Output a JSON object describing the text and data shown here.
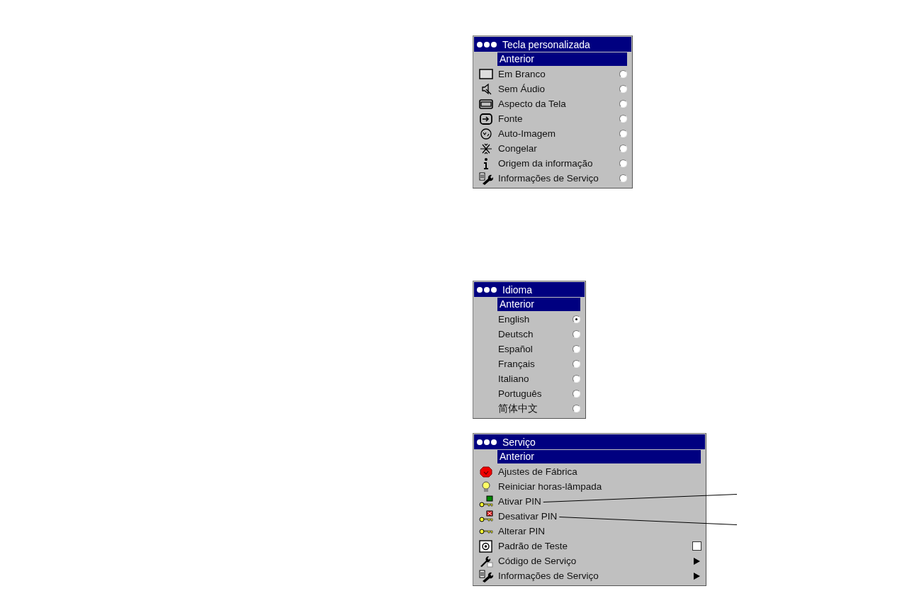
{
  "menus": [
    {
      "title": "Tecla personalizada",
      "back": {
        "label": "Anterior",
        "selected": true
      },
      "items": [
        {
          "kind": "radio",
          "label": "Em Branco",
          "selected": false
        },
        {
          "kind": "radio",
          "label": "Sem Áudio",
          "selected": false
        },
        {
          "kind": "radio",
          "label": "Aspecto da Tela",
          "selected": false
        },
        {
          "kind": "radio",
          "label": "Fonte",
          "selected": false
        },
        {
          "kind": "radio",
          "label": "Auto-Imagem",
          "selected": false
        },
        {
          "kind": "radio",
          "label": "Congelar",
          "selected": false
        },
        {
          "kind": "radio",
          "label": "Origem da informação",
          "selected": false
        },
        {
          "kind": "radio",
          "label": "Informações de Serviço",
          "selected": false
        }
      ]
    },
    {
      "title": "Idioma",
      "back": {
        "label": "Anterior",
        "selected": true
      },
      "items": [
        {
          "kind": "radio",
          "label": "English",
          "selected": true
        },
        {
          "kind": "radio",
          "label": "Deutsch",
          "selected": false
        },
        {
          "kind": "radio",
          "label": "Español",
          "selected": false
        },
        {
          "kind": "radio",
          "label": "Français",
          "selected": false
        },
        {
          "kind": "radio",
          "label": "Italiano",
          "selected": false
        },
        {
          "kind": "radio",
          "label": "Português",
          "selected": false
        },
        {
          "kind": "radio",
          "label": "简体中文",
          "selected": false
        }
      ]
    },
    {
      "title": "Serviço",
      "back": {
        "label": "Anterior",
        "selected": true
      },
      "items": [
        {
          "kind": "action",
          "label": "Ajustes de Fábrica",
          "leader_line": false
        },
        {
          "kind": "action",
          "label": "Reiniciar horas-lâmpada",
          "leader_line": false
        },
        {
          "kind": "action",
          "label": "Ativar PIN",
          "leader_line": true
        },
        {
          "kind": "action",
          "label": "Desativar PIN",
          "leader_line": true
        },
        {
          "kind": "action",
          "label": "Alterar PIN",
          "leader_line": false
        },
        {
          "kind": "checkbox",
          "label": "Padrão de Teste",
          "checked": false,
          "leader_line": false
        },
        {
          "kind": "submenu",
          "label": "Código de Serviço",
          "leader_line": false
        },
        {
          "kind": "submenu",
          "label": "Informações de Serviço",
          "leader_line": false
        }
      ]
    }
  ]
}
